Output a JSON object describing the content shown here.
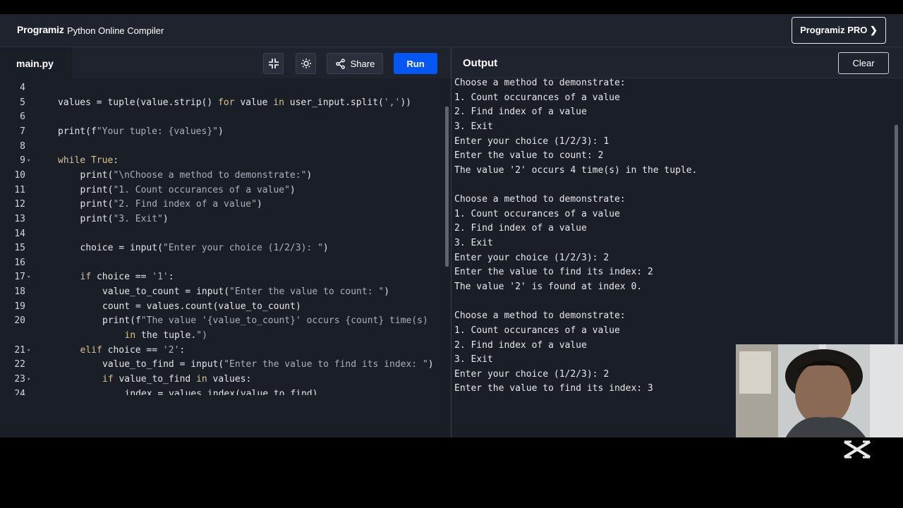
{
  "header": {
    "logo": "Programiz",
    "title": "Python Online Compiler",
    "pro_button": "Programiz PRO ❯"
  },
  "editor": {
    "file_tab": "main.py",
    "share_label": "Share",
    "run_label": "Run",
    "lines": [
      {
        "n": "4",
        "fold": "",
        "indent": 0,
        "code": ""
      },
      {
        "n": "5",
        "fold": "",
        "indent": 0,
        "code": "values = tuple(value.strip() for value in user_input.split(','))"
      },
      {
        "n": "6",
        "fold": "",
        "indent": 0,
        "code": ""
      },
      {
        "n": "7",
        "fold": "",
        "indent": 0,
        "code": "print(f\"Your tuple: {values}\")"
      },
      {
        "n": "8",
        "fold": "",
        "indent": 0,
        "code": ""
      },
      {
        "n": "9",
        "fold": "▾",
        "indent": 0,
        "code": "while True:"
      },
      {
        "n": "10",
        "fold": "",
        "indent": 1,
        "code": "print(\"\\nChoose a method to demonstrate:\")"
      },
      {
        "n": "11",
        "fold": "",
        "indent": 1,
        "code": "print(\"1. Count occurances of a value\")"
      },
      {
        "n": "12",
        "fold": "",
        "indent": 1,
        "code": "print(\"2. Find index of a value\")"
      },
      {
        "n": "13",
        "fold": "",
        "indent": 1,
        "code": "print(\"3. Exit\")"
      },
      {
        "n": "14",
        "fold": "",
        "indent": 0,
        "code": ""
      },
      {
        "n": "15",
        "fold": "",
        "indent": 1,
        "code": "choice = input(\"Enter your choice (1/2/3): \")"
      },
      {
        "n": "16",
        "fold": "",
        "indent": 0,
        "code": ""
      },
      {
        "n": "17",
        "fold": "▾",
        "indent": 1,
        "code": "if choice == '1':"
      },
      {
        "n": "18",
        "fold": "",
        "indent": 2,
        "code": "value_to_count = input(\"Enter the value to count: \")"
      },
      {
        "n": "19",
        "fold": "",
        "indent": 2,
        "code": "count = values.count(value_to_count)"
      },
      {
        "n": "20",
        "fold": "",
        "indent": 2,
        "code": "print(f\"The value '{value_to_count}' occurs {count} time(s)"
      },
      {
        "n": "",
        "fold": "",
        "indent": 3,
        "code": "in the tuple.\")"
      },
      {
        "n": "21",
        "fold": "▾",
        "indent": 1,
        "code": "elif choice == '2':"
      },
      {
        "n": "22",
        "fold": "",
        "indent": 2,
        "code": "value_to_find = input(\"Enter the value to find its index: \")"
      },
      {
        "n": "23",
        "fold": "▾",
        "indent": 2,
        "code": "if value_to_find in values:"
      },
      {
        "n": "24",
        "fold": "",
        "indent": 3,
        "code": "index = values.index(value_to_find)"
      }
    ]
  },
  "output": {
    "title": "Output",
    "clear_label": "Clear",
    "lines": [
      "Choose a method to demonstrate:",
      "1. Count occurances of a value",
      "2. Find index of a value",
      "3. Exit",
      "Enter your choice (1/2/3): 1",
      "Enter the value to count: 2",
      "The value '2' occurs 4 time(s) in the tuple.",
      "",
      "Choose a method to demonstrate:",
      "1. Count occurances of a value",
      "2. Find index of a value",
      "3. Exit",
      "Enter your choice (1/2/3): 2",
      "Enter the value to find its index: 2",
      "The value '2' is found at index 0.",
      "",
      "Choose a method to demonstrate:",
      "1. Count occurances of a value",
      "2. Find index of a value",
      "3. Exit",
      "Enter your choice (1/2/3): 2",
      "Enter the value to find its index: 3"
    ]
  },
  "icons": {
    "collapse": "collapse-icon",
    "theme": "sun-icon",
    "share": "share-icon",
    "capcut": "capcut-logo"
  },
  "colors": {
    "run_button": "#0556f3",
    "editor_bg": "#1a1e27",
    "header_bg": "#1f232d"
  }
}
